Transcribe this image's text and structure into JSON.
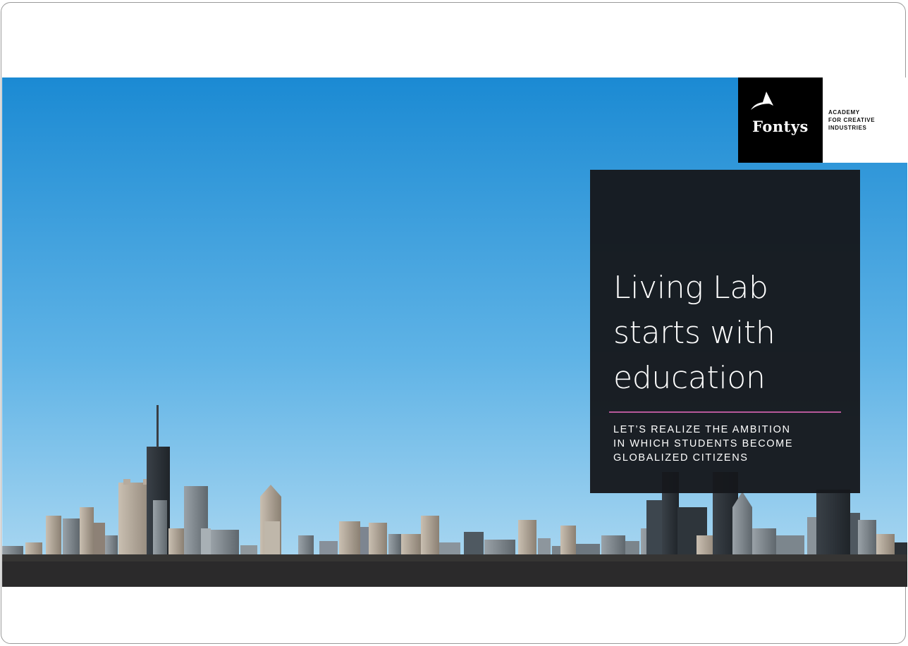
{
  "logo": {
    "wordmark": "Fontys",
    "lines": [
      "ACADEMY",
      "FOR CREATIVE",
      "INDUSTRIES"
    ]
  },
  "title": {
    "lines": [
      "Living Lab",
      "starts with",
      "education"
    ]
  },
  "subtitle": {
    "lines": [
      "LET’S REALIZE THE AMBITION",
      "IN WHICH STUDENTS BECOME",
      "GLOBALIZED CITIZENS"
    ]
  },
  "colors": {
    "sky_top": "#1f8fd6",
    "sky_bottom": "#a9d6f0",
    "card": "#16181c",
    "accent": "#b8589a"
  }
}
